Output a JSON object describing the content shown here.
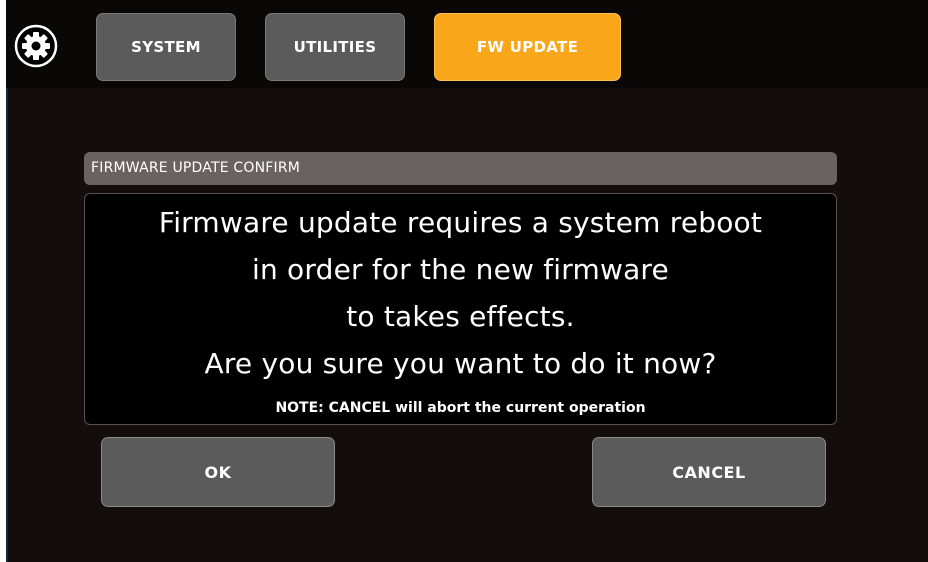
{
  "tabs": [
    {
      "label": "SYSTEM",
      "active": false
    },
    {
      "label": "UTILITIES",
      "active": false
    },
    {
      "label": "FW UPDATE",
      "active": true
    }
  ],
  "settings_icon": "gear-icon",
  "dialog": {
    "title": "FIRMWARE UPDATE CONFIRM",
    "message_lines": [
      "Firmware update requires a system reboot",
      "in order for the new firmware",
      "to takes effects.",
      "Are you sure you want to do it now?"
    ],
    "note": "NOTE: CANCEL will abort the current operation",
    "ok_label": "OK",
    "cancel_label": "CANCEL"
  },
  "colors": {
    "accent": "#faa61a",
    "tab_inactive": "#5b5b5b",
    "background": "#130e0b",
    "dialog_header": "#6a6262"
  }
}
